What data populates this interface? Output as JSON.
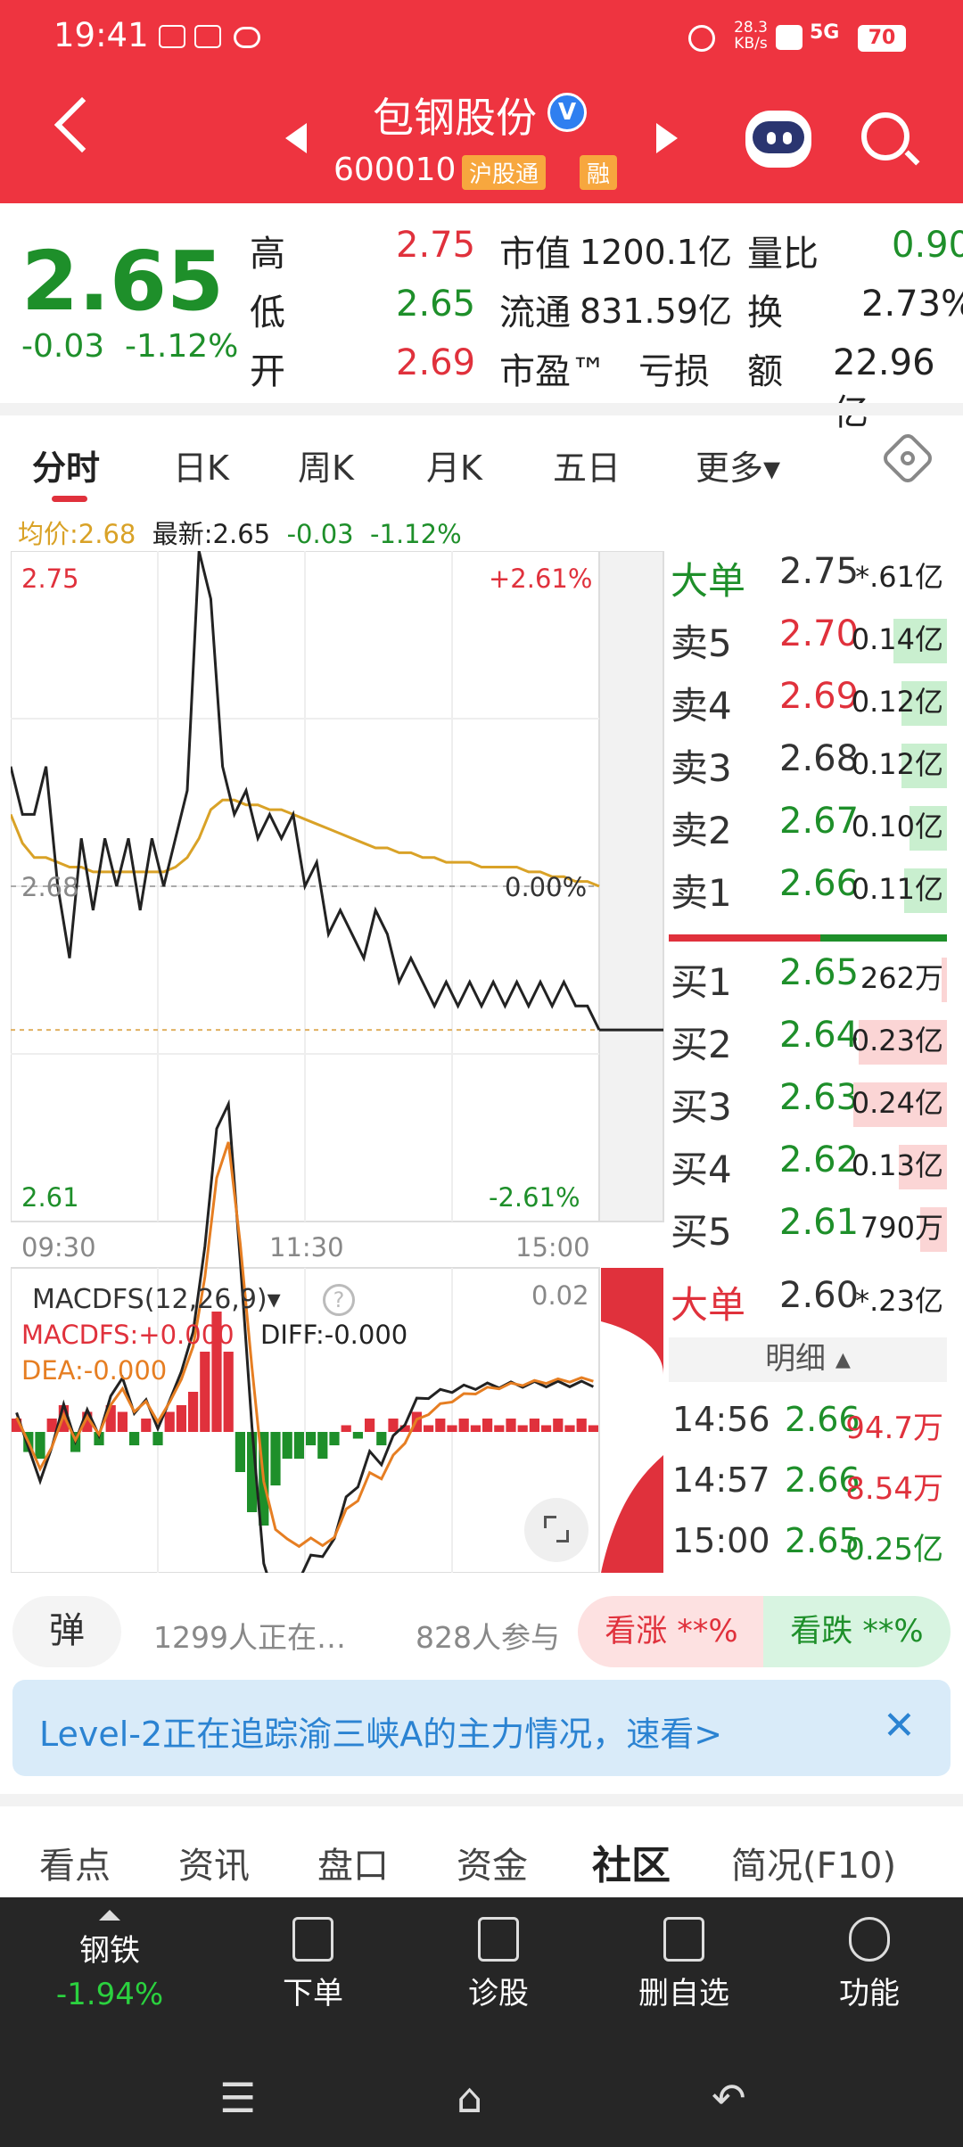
{
  "status": {
    "time": "19:41",
    "speed": "28.3\nKB/s",
    "battery": "70",
    "net": "5G"
  },
  "header": {
    "name": "包钢股份",
    "verified": "V",
    "code": "600010",
    "tag1": "沪股通",
    "tag2": "融"
  },
  "quote": {
    "price": "2.65",
    "change": "-0.03",
    "change_pct": "-1.12%",
    "rows": [
      {
        "l1": "高",
        "v1": "2.75",
        "c1": "red",
        "l2": "市值",
        "v2": "1200.1亿",
        "l3": "量比",
        "v3": "0.90",
        "c3": "green"
      },
      {
        "l1": "低",
        "v1": "2.65",
        "c1": "green",
        "l2": "流通",
        "v2": "831.59亿",
        "l3": "换",
        "v3": "2.73%",
        "c3": "dark"
      },
      {
        "l1": "开",
        "v1": "2.69",
        "c1": "red",
        "l2": "市盈™",
        "v2": "亏损",
        "l3": "额",
        "v3": "22.96亿",
        "c3": "dark"
      }
    ]
  },
  "tabs": [
    "分时",
    "日K",
    "周K",
    "月K",
    "五日",
    "更多▾"
  ],
  "info": {
    "avg_label": "均价:2.68",
    "latest": "最新:2.65",
    "chg": "-0.03",
    "pct": "-1.12%"
  },
  "chart": {
    "ymax": "2.75",
    "ymin": "2.61",
    "pmax": "+2.61%",
    "pmin": "-2.61%",
    "mid": "2.68",
    "midp": "0.00%",
    "times": [
      "09:30",
      "11:30",
      "15:00"
    ]
  },
  "chart_data": {
    "type": "line",
    "x": [
      0,
      2,
      4,
      6,
      8,
      10,
      12,
      14,
      16,
      18,
      20,
      22,
      24,
      26,
      28,
      30,
      32,
      34,
      36,
      38,
      40,
      42,
      44,
      46,
      48,
      50,
      52,
      54,
      56,
      58,
      60,
      62,
      64,
      66,
      68,
      70,
      72,
      74,
      76,
      78,
      80,
      82,
      84,
      86,
      88,
      90,
      92,
      94,
      96,
      98,
      100
    ],
    "series": [
      {
        "name": "价格",
        "values": [
          2.705,
          2.695,
          2.695,
          2.705,
          2.68,
          2.665,
          2.69,
          2.675,
          2.69,
          2.68,
          2.69,
          2.675,
          2.69,
          2.68,
          2.69,
          2.7,
          2.75,
          2.74,
          2.705,
          2.695,
          2.7,
          2.69,
          2.695,
          2.69,
          2.695,
          2.68,
          2.685,
          2.67,
          2.675,
          2.67,
          2.665,
          2.675,
          2.67,
          2.66,
          2.665,
          2.66,
          2.655,
          2.66,
          2.655,
          2.66,
          2.655,
          2.66,
          2.655,
          2.66,
          2.655,
          2.66,
          2.655,
          2.66,
          2.655,
          2.655,
          2.65
        ]
      },
      {
        "name": "均价",
        "values": [
          2.695,
          2.689,
          2.686,
          2.686,
          2.685,
          2.684,
          2.684,
          2.683,
          2.683,
          2.683,
          2.683,
          2.683,
          2.683,
          2.683,
          2.684,
          2.686,
          2.69,
          2.696,
          2.698,
          2.698,
          2.697,
          2.697,
          2.696,
          2.696,
          2.695,
          2.694,
          2.693,
          2.692,
          2.691,
          2.69,
          2.689,
          2.688,
          2.688,
          2.687,
          2.687,
          2.686,
          2.686,
          2.685,
          2.685,
          2.685,
          2.684,
          2.684,
          2.684,
          2.684,
          2.683,
          2.683,
          2.682,
          2.682,
          2.681,
          2.681,
          2.68
        ]
      }
    ],
    "ylim": [
      2.61,
      2.75
    ]
  },
  "macd": {
    "title": "MACDFS(12,26,9)▾",
    "val": "MACDFS:+0.000",
    "diff": "DIFF:-0.000",
    "dea": "DEA:-0.000",
    "top": "0.02",
    "hist": [
      0.002,
      -0.003,
      -0.004,
      0.002,
      0.004,
      -0.003,
      0.003,
      -0.002,
      0.004,
      0.003,
      -0.002,
      0.002,
      -0.002,
      0.003,
      0.004,
      0.006,
      0.012,
      0.018,
      0.012,
      -0.006,
      -0.012,
      -0.014,
      -0.008,
      -0.004,
      -0.004,
      -0.002,
      -0.004,
      -0.002,
      0.001,
      -0.001,
      0.002,
      -0.002,
      0.002,
      0.001,
      0.003,
      0.001,
      0.002,
      0.001,
      0.002,
      0.001,
      0.002,
      0.001,
      0.002,
      0.001,
      0.002,
      0.001,
      0.002,
      0.001,
      0.002,
      0.001
    ]
  },
  "orderbook": {
    "big_sell": {
      "label": "大单",
      "price": "2.75",
      "vol": "*.61亿"
    },
    "asks": [
      {
        "label": "卖5",
        "price": "2.70",
        "vol": "0.14亿",
        "c": "red",
        "bar": 0.2
      },
      {
        "label": "卖4",
        "price": "2.69",
        "vol": "0.12亿",
        "c": "red",
        "bar": 0.17
      },
      {
        "label": "卖3",
        "price": "2.68",
        "vol": "0.12亿",
        "c": "dark",
        "bar": 0.17
      },
      {
        "label": "卖2",
        "price": "2.67",
        "vol": "0.10亿",
        "c": "green",
        "bar": 0.14
      },
      {
        "label": "卖1",
        "price": "2.66",
        "vol": "0.11亿",
        "c": "green",
        "bar": 0.16
      }
    ],
    "bids": [
      {
        "label": "买1",
        "price": "2.65",
        "vol": "262万",
        "c": "green",
        "bar": 0.02
      },
      {
        "label": "买2",
        "price": "2.64",
        "vol": "0.23亿",
        "c": "green",
        "bar": 0.33
      },
      {
        "label": "买3",
        "price": "2.63",
        "vol": "0.24亿",
        "c": "green",
        "bar": 0.35
      },
      {
        "label": "买4",
        "price": "2.62",
        "vol": "0.13亿",
        "c": "green",
        "bar": 0.18
      },
      {
        "label": "买5",
        "price": "2.61",
        "vol": "790万",
        "c": "green",
        "bar": 0.1
      }
    ],
    "big_buy": {
      "label": "大单",
      "price": "2.60",
      "vol": "*.23亿"
    }
  },
  "detail": {
    "title": "明细 ▴",
    "trades": [
      {
        "t": "14:56",
        "p": "2.66",
        "v": "94.7万"
      },
      {
        "t": "14:57",
        "p": "2.66",
        "v": "8.54万"
      },
      {
        "t": "15:00",
        "p": "2.65",
        "v": "0.25亿"
      }
    ]
  },
  "social": {
    "dan": "弹",
    "watching": "1299人正在…",
    "participants": "828人参与",
    "bull": "看涨 **%",
    "bear": "看跌 **%"
  },
  "banner": {
    "text": "Level-2正在追踪渝三峡A的主力情况，速看>",
    "close": "✕"
  },
  "bottom_tabs": [
    "看点",
    "资讯",
    "盘口",
    "资金",
    "社区",
    "简况(F10)"
  ],
  "nav": [
    {
      "label": "钢铁",
      "sub": "-1.94%"
    },
    {
      "label": "下单"
    },
    {
      "label": "诊股"
    },
    {
      "label": "删自选"
    },
    {
      "label": "功能"
    }
  ],
  "colors": {
    "red": "#e0313c",
    "green": "#1e8f2a",
    "header": "#ee3440",
    "avg": "#d9a227"
  }
}
